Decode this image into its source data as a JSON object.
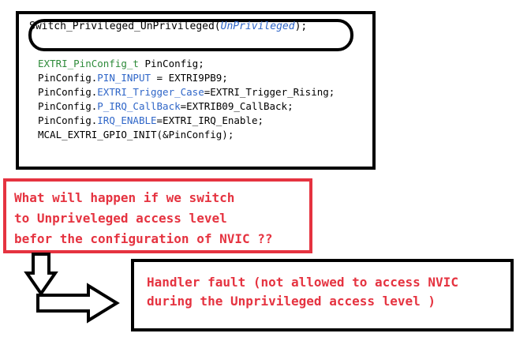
{
  "code_panel": {
    "switch_line_fn": "Switch_Privileged_UnPrivileged(",
    "switch_line_arg": "UnPrivileged",
    "switch_line_end": ");",
    "line1_type": "EXTRI_PinConfig_t",
    "line1_rest": " PinConfig;",
    "line2_obj": "PinConfig.",
    "line2_field": "PIN_INPUT",
    "line2_rest": " = EXTRI9PB9;",
    "line3_obj": "PinConfig.",
    "line3_field": "EXTRI_Trigger_Case",
    "line3_rest": "=EXTRI_Trigger_Rising;",
    "line4_obj": "PinConfig.",
    "line4_field": "P_IRQ_CallBack",
    "line4_rest": "=EXTRIB09_CallBack;",
    "line5_obj": "PinConfig.",
    "line5_field": "IRQ_ENABLE",
    "line5_rest": "=EXTRI_IRQ_Enable;",
    "line6": "MCAL_EXTRI_GPIO_INIT(&PinConfig);"
  },
  "question": {
    "text": "What will happen if we switch\nto Unpriveleged access level\nbefor the configuration of NVIC ??"
  },
  "answer": {
    "text": "Handler fault (not allowed to access NVIC\nduring the Unprivileged access level )"
  },
  "colors": {
    "red": "#e53340",
    "code_green": "#2e8b3a",
    "code_blue": "#2f66c8"
  }
}
